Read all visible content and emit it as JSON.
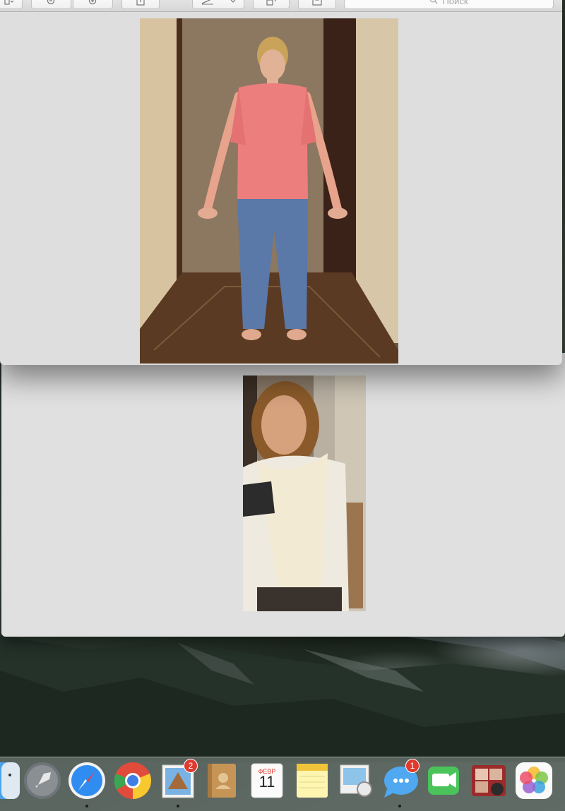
{
  "window": {
    "search_placeholder": "Поиск",
    "toolbar_icons": [
      "sidebar-chevron-icon",
      "zoom-out-icon",
      "zoom-in-icon",
      "share-icon",
      "markup-pen-icon",
      "rotate-icon",
      "toolbox-icon",
      "search-icon"
    ]
  },
  "photos": [
    {
      "name": "photo-woman-pink-shirt",
      "description_kind": "photo"
    },
    {
      "name": "photo-woman-white-scarf",
      "description_kind": "photo"
    }
  ],
  "dock": {
    "items": [
      {
        "name": "finder",
        "running": false
      },
      {
        "name": "launchpad",
        "running": false
      },
      {
        "name": "safari",
        "running": true
      },
      {
        "name": "chrome",
        "running": false
      },
      {
        "name": "mail",
        "running": true,
        "badge": "2"
      },
      {
        "name": "contacts",
        "running": false
      },
      {
        "name": "calendar",
        "running": false,
        "month": "ФЕВР",
        "day": "11"
      },
      {
        "name": "notes",
        "running": false
      },
      {
        "name": "preview",
        "running": true
      },
      {
        "name": "messages",
        "running": true,
        "badge": "1"
      },
      {
        "name": "facetime",
        "running": false
      },
      {
        "name": "photo-booth",
        "running": false
      },
      {
        "name": "photos",
        "running": false
      }
    ]
  },
  "colors": {
    "accent_red": "#e03a2f",
    "window_bg": "#e0e0e0"
  }
}
